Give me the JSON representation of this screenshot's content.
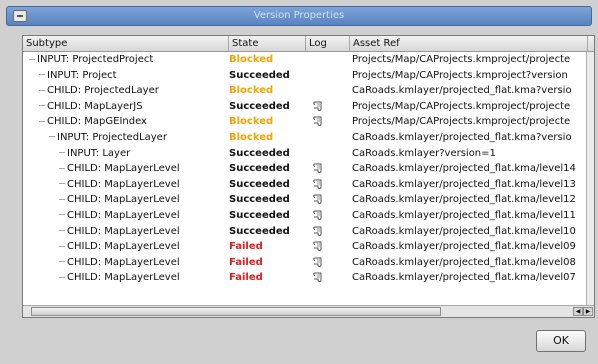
{
  "window": {
    "title": "Version Properties"
  },
  "columns": {
    "subtype": "Subtype",
    "state": "State",
    "log": "Log",
    "asset_ref": "Asset Ref"
  },
  "rows": [
    {
      "subtype": "INPUT: ProjectedProject",
      "indent": 0,
      "state": "Blocked",
      "log": false,
      "asset": "Projects/Map/CAProjects.kmproject/projecte"
    },
    {
      "subtype": "INPUT: Project",
      "indent": 1,
      "state": "Succeeded",
      "log": false,
      "asset": "Projects/Map/CAProjects.kmproject?version"
    },
    {
      "subtype": "CHILD: ProjectedLayer",
      "indent": 1,
      "state": "Blocked",
      "log": false,
      "asset": "CaRoads.kmlayer/projected_flat.kma?versio"
    },
    {
      "subtype": "CHILD: MapLayerJS",
      "indent": 1,
      "state": "Succeeded",
      "log": true,
      "asset": "Projects/Map/CAProjects.kmproject/projecte"
    },
    {
      "subtype": "CHILD: MapGEIndex",
      "indent": 1,
      "state": "Blocked",
      "log": true,
      "asset": "Projects/Map/CAProjects.kmproject/projecte"
    },
    {
      "subtype": "INPUT: ProjectedLayer",
      "indent": 2,
      "state": "Blocked",
      "log": false,
      "asset": "CaRoads.kmlayer/projected_flat.kma?versio"
    },
    {
      "subtype": "INPUT: Layer",
      "indent": 3,
      "state": "Succeeded",
      "log": false,
      "asset": "CaRoads.kmlayer?version=1"
    },
    {
      "subtype": "CHILD: MapLayerLevel",
      "indent": 3,
      "state": "Succeeded",
      "log": true,
      "asset": "CaRoads.kmlayer/projected_flat.kma/level14"
    },
    {
      "subtype": "CHILD: MapLayerLevel",
      "indent": 3,
      "state": "Succeeded",
      "log": true,
      "asset": "CaRoads.kmlayer/projected_flat.kma/level13"
    },
    {
      "subtype": "CHILD: MapLayerLevel",
      "indent": 3,
      "state": "Succeeded",
      "log": true,
      "asset": "CaRoads.kmlayer/projected_flat.kma/level12"
    },
    {
      "subtype": "CHILD: MapLayerLevel",
      "indent": 3,
      "state": "Succeeded",
      "log": true,
      "asset": "CaRoads.kmlayer/projected_flat.kma/level11"
    },
    {
      "subtype": "CHILD: MapLayerLevel",
      "indent": 3,
      "state": "Succeeded",
      "log": true,
      "asset": "CaRoads.kmlayer/projected_flat.kma/level10"
    },
    {
      "subtype": "CHILD: MapLayerLevel",
      "indent": 3,
      "state": "Failed",
      "log": true,
      "asset": "CaRoads.kmlayer/projected_flat.kma/level09"
    },
    {
      "subtype": "CHILD: MapLayerLevel",
      "indent": 3,
      "state": "Failed",
      "log": true,
      "asset": "CaRoads.kmlayer/projected_flat.kma/level08"
    },
    {
      "subtype": "CHILD: MapLayerLevel",
      "indent": 3,
      "state": "Failed",
      "log": true,
      "asset": "CaRoads.kmlayer/projected_flat.kma/level07"
    }
  ],
  "icons": {
    "log": "scroll-log-icon",
    "system_menu": "window-menu-icon"
  },
  "colors": {
    "blocked": "#f0a400",
    "succeeded": "#111111",
    "failed": "#e01e1e",
    "titlebar": "#6a93cc"
  },
  "buttons": {
    "ok": "OK"
  }
}
